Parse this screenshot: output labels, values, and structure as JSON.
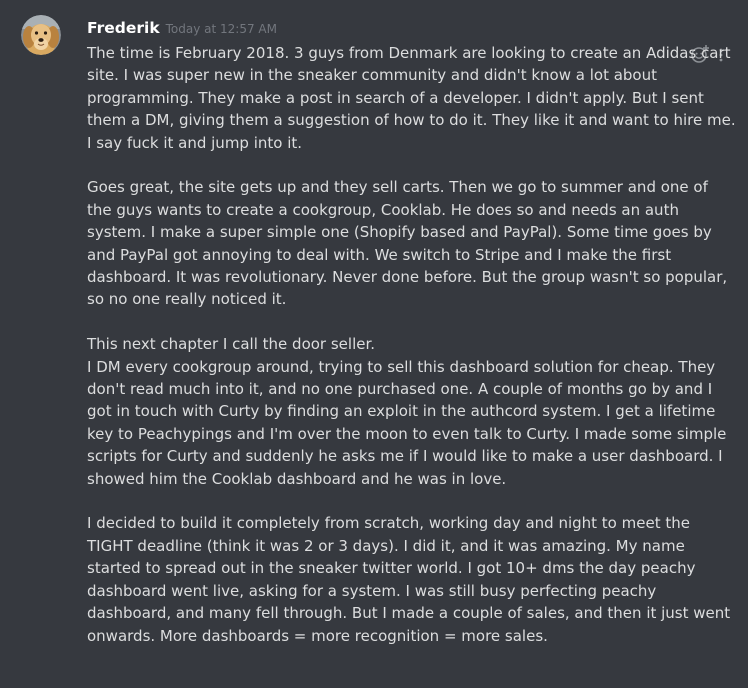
{
  "message": {
    "author": "Frederik",
    "timestamp": "Today at 12:57 AM",
    "avatar_icon": "golden-retriever-avatar",
    "paragraphs": [
      "The time is February 2018. 3 guys from Denmark are looking to create an Adidas cart site. I was super new in the sneaker community and didn't know a lot about programming. They make a post in search of a developer. I didn't apply. But I sent them a DM, giving them a suggestion of how to do it. They like it and want to hire me. I say fuck it and jump into it.",
      "Goes great, the site gets up and they sell carts. Then we go to summer and one of the guys wants to create a cookgroup, Cooklab. He does so and needs an auth system. I make a super simple one (Shopify based and PayPal). Some time goes by and PayPal got annoying to deal with. We switch to Stripe and I make the first dashboard. It was revolutionary. Never done before. But the group wasn't so popular, so no one really noticed it.",
      "This next chapter I call the door seller.",
      "I DM every cookgroup around, trying to sell this dashboard solution for cheap. They don't read much into it, and no one purchased one. A couple of months go by and I got in touch with Curty by finding an exploit in the authcord system. I get a lifetime key to Peachypings and I'm over the moon to even talk to Curty. I made some simple scripts for Curty and suddenly he asks me if I would like to make a user dashboard. I showed him the Cooklab dashboard and he was in love.",
      "I decided to build it completely from scratch, working day and night to meet the TIGHT deadline (think it was 2 or 3 days). I did it, and it was amazing. My name started to spread out in the sneaker twitter world. I got 10+ dms the day peachy dashboard went live, asking for a system. I was still busy perfecting peachy dashboard, and many fell through. But I made a couple of sales, and then it just went onwards. More dashboards = more recognition = more sales."
    ]
  },
  "actions": [
    {
      "icon": "add-reaction-icon"
    },
    {
      "icon": "more-options-icon"
    }
  ],
  "colors": {
    "background": "#36393f",
    "text": "#dcddde",
    "username": "#ffffff",
    "timestamp": "#72767d",
    "icon": "#b9bbbe"
  }
}
